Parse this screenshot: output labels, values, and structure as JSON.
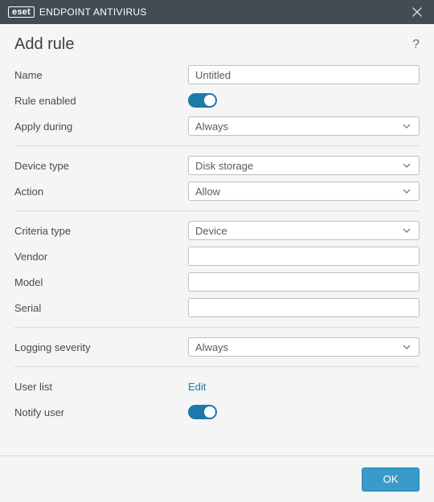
{
  "titlebar": {
    "brand_box": "eset",
    "brand_text": "ENDPOINT ANTIVIRUS"
  },
  "header": {
    "title": "Add rule",
    "help_tooltip": "?"
  },
  "fields": {
    "name": {
      "label": "Name",
      "value": "Untitled"
    },
    "rule_enabled": {
      "label": "Rule enabled",
      "value": true
    },
    "apply_during": {
      "label": "Apply during",
      "value": "Always"
    },
    "device_type": {
      "label": "Device type",
      "value": "Disk storage"
    },
    "action": {
      "label": "Action",
      "value": "Allow"
    },
    "criteria_type": {
      "label": "Criteria type",
      "value": "Device"
    },
    "vendor": {
      "label": "Vendor",
      "value": ""
    },
    "model": {
      "label": "Model",
      "value": ""
    },
    "serial": {
      "label": "Serial",
      "value": ""
    },
    "logging_severity": {
      "label": "Logging severity",
      "value": "Always"
    },
    "user_list": {
      "label": "User list",
      "action_label": "Edit"
    },
    "notify_user": {
      "label": "Notify user",
      "value": true
    }
  },
  "footer": {
    "ok": "OK"
  }
}
